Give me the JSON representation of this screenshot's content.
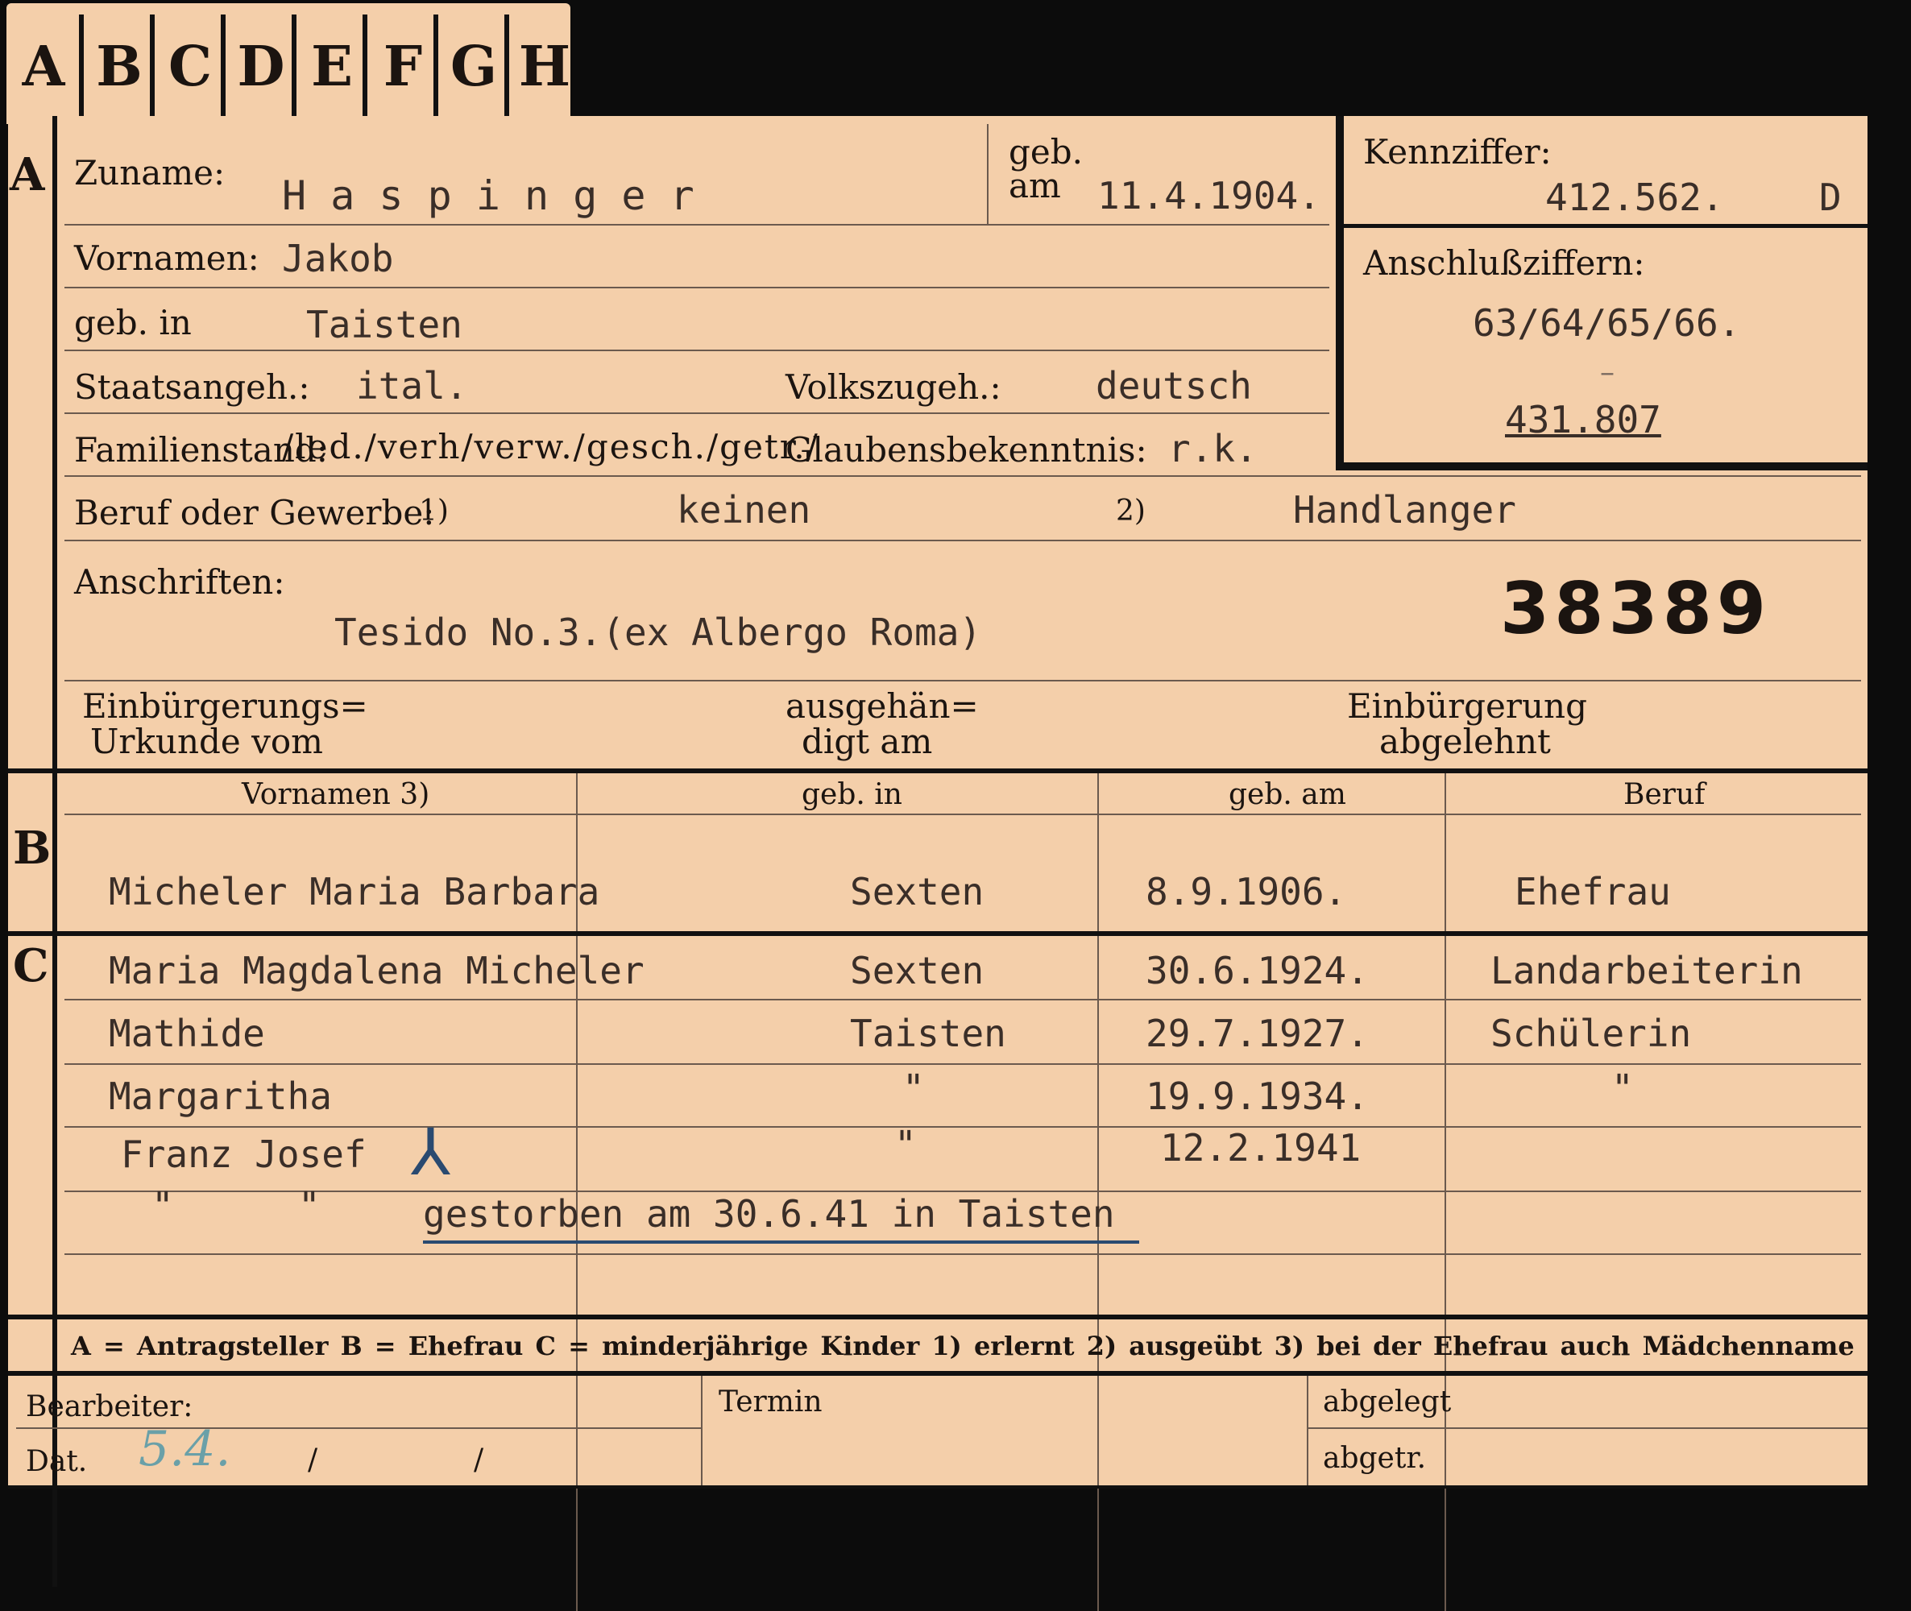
{
  "tabs": [
    "A",
    "B",
    "C",
    "D",
    "E",
    "F",
    "G",
    "H"
  ],
  "section_a": {
    "marker": "A",
    "zuname_label": "Zuname:",
    "zuname_value": "H a s p i n g e r",
    "geb_am_label_1": "geb.",
    "geb_am_label_2": "am",
    "geb_am_value": "11.4.1904.",
    "vornamen_label": "Vornamen:",
    "vornamen_value": "Jakob",
    "geb_in_label": "geb. in",
    "geb_in_value": "Taisten",
    "staatsangeh_label": "Staatsangeh.:",
    "staatsangeh_value": "ital.",
    "volkszugeh_label": "Volkszugeh.:",
    "volkszugeh_value": "deutsch",
    "familienstand_label": "Familienstand:",
    "familienstand_options": "/led./verh/verw./gesch./getr./",
    "glaubens_label": "Glaubensbekenntnis:",
    "glaubens_value": "r.k.",
    "beruf_label": "Beruf oder Gewerbe:",
    "beruf_fn1": "1)",
    "beruf_value1": "keinen",
    "beruf_fn2": "2)",
    "beruf_value2": "Handlanger",
    "anschriften_label": "Anschriften:",
    "anschriften_value": "Tesido No.3.(ex Albergo Roma)",
    "number": "38389",
    "einb_urkunde_1": "Einbürgerungs=",
    "einb_urkunde_2": "Urkunde vom",
    "ausgehaendigt_1": "ausgehän=",
    "ausgehaendigt_2": "digt am",
    "einb_abgelehnt_1": "Einbürgerung",
    "einb_abgelehnt_2": "abgelehnt"
  },
  "kennziffer": {
    "label": "Kennziffer:",
    "value": "412.562.",
    "suffix": "D",
    "anschluss_label": "Anschlußziffern:",
    "anschluss_value": "63/64/65/66.",
    "dash": "–",
    "anschluss_value2": "431.807"
  },
  "section_b": {
    "marker": "B",
    "headers": [
      "Vornamen 3)",
      "geb. in",
      "geb. am",
      "Beruf"
    ],
    "row": [
      "Micheler Maria Barbara",
      "Sexten",
      "8.9.1906.",
      "Ehefrau"
    ]
  },
  "section_c": {
    "marker": "C",
    "rows": [
      [
        "Maria Magdalena Micheler",
        "Sexten",
        "30.6.1924.",
        "Landarbeiterin"
      ],
      [
        "Mathide",
        "Taisten",
        "29.7.1927.",
        "Schülerin"
      ],
      [
        "Margaritha",
        "\"",
        "19.9.1934.",
        "\""
      ],
      [
        "Franz Josef",
        "\"",
        "12.2.1941",
        ""
      ]
    ],
    "death_cross": "⅄",
    "note_ditto1": "\"",
    "note_ditto2": "\"",
    "note": "gestorben am 30.6.41 in Taisten"
  },
  "legend": "A = Antragsteller   B = Ehefrau   C = minderjährige Kinder   1) erlernt   2) ausgeübt   3) bei der Ehefrau auch Mädchenname",
  "footer": {
    "bearbeiter_label": "Bearbeiter:",
    "dat_label": "Dat.",
    "dat_value": "5.4.",
    "slash1": "/",
    "slash2": "/",
    "termin_label": "Termin",
    "abgelegt_label": "abgelegt",
    "abgetr_label": "abgetr."
  }
}
